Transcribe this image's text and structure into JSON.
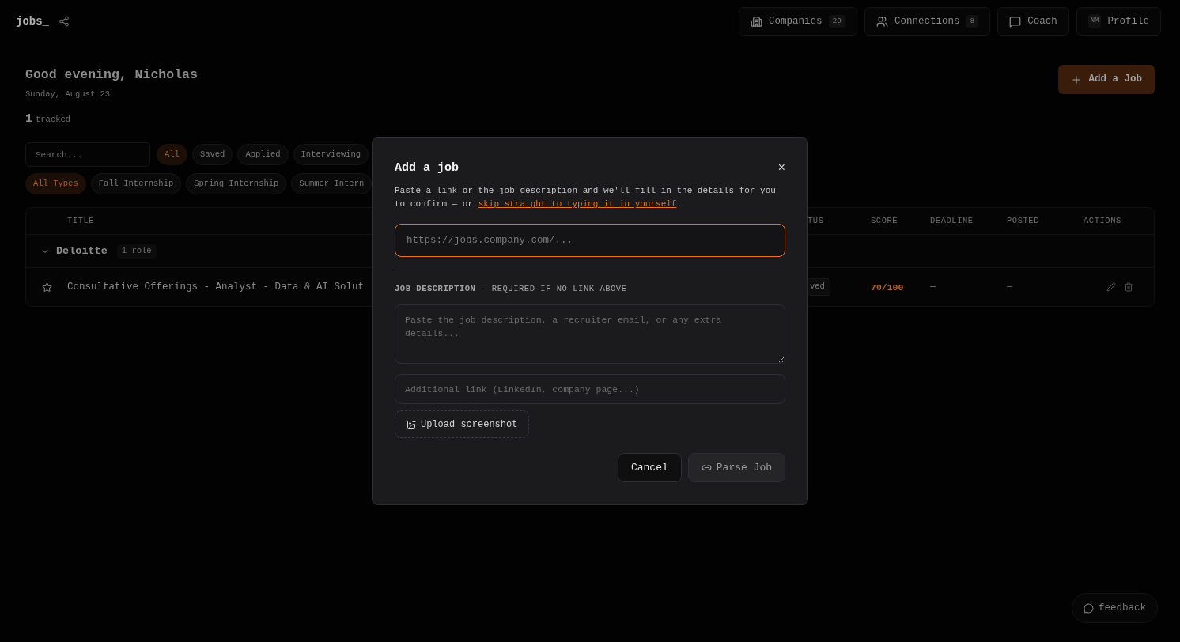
{
  "header": {
    "logo": "jobs_"
  },
  "nav": [
    {
      "kind": "building",
      "label": "Companies",
      "count": "29"
    },
    {
      "kind": "users",
      "label": "Connections",
      "count": "8"
    },
    {
      "kind": "chat",
      "label": "Coach"
    },
    {
      "kind": "avatar",
      "label": "Profile",
      "initials": "NM"
    }
  ],
  "greeting": {
    "title": "Good evening, Nicholas",
    "date": "Sunday, August 23"
  },
  "add_button": "Add a Job",
  "tracked": {
    "count": "1",
    "label": "tracked"
  },
  "search": {
    "placeholder": "Search..."
  },
  "status_filters": [
    {
      "label": "All",
      "selected": true
    },
    {
      "label": "Saved",
      "selected": false
    },
    {
      "label": "Applied",
      "selected": false
    },
    {
      "label": "Interviewing",
      "selected": false
    }
  ],
  "type_filters": [
    {
      "label": "All Types",
      "selected": true
    },
    {
      "label": "Fall Internship",
      "selected": false
    },
    {
      "label": "Spring Internship",
      "selected": false
    },
    {
      "label": "Summer Intern",
      "selected": false
    }
  ],
  "table": {
    "columns": [
      "TITLE",
      "TUS",
      "SCORE",
      "DEADLINE",
      "POSTED",
      "ACTIONS"
    ],
    "groups": [
      {
        "company": "Deloitte",
        "count": "1 role",
        "expanded": true,
        "rows": [
          {
            "title": "Consultative Offerings - Analyst - Data & AI Solut",
            "starred": false,
            "status": "ved",
            "score": "70/100",
            "deadline": "—",
            "posted": "—"
          }
        ]
      }
    ]
  },
  "dialog": {
    "title": "Add a job",
    "close": "×",
    "description": {
      "before": "Paste a link or the job description and we'll fill in the details for you to confirm — or ",
      "link": "skip straight to typing it in yourself",
      "after": "."
    },
    "url_field": {
      "placeholder": "https://jobs.company.com/...",
      "focused": true
    },
    "section_label": "**JOB DESCRIPTION** — REQUIRED IF NO LINK ABOVE",
    "description_field": {
      "placeholder": "Paste the job description, a recruiter email, or any extra details..."
    },
    "link_field": {
      "placeholder": "Additional link (LinkedIn, company page...)"
    },
    "upload_button": "Upload screenshot",
    "cancel_button": "Cancel",
    "parse_button": {
      "label": "Parse Job",
      "disabled": true
    }
  },
  "feedback": "feedback"
}
